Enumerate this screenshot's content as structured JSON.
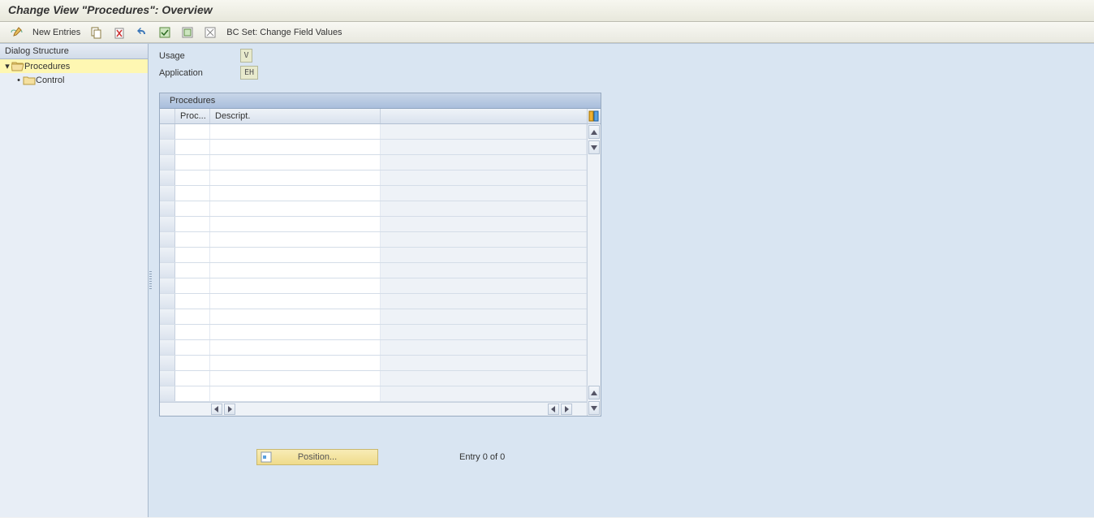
{
  "title": "Change View \"Procedures\": Overview",
  "toolbar": {
    "new_entries": "New Entries",
    "bc_set": "BC Set: Change Field Values"
  },
  "sidebar": {
    "header": "Dialog Structure",
    "root": {
      "label": "Procedures",
      "expanded": true,
      "selected": true
    },
    "child": {
      "label": "Control"
    }
  },
  "fields": {
    "usage_label": "Usage",
    "usage_value": "V",
    "application_label": "Application",
    "application_value": "EH"
  },
  "table": {
    "title": "Procedures",
    "col_proc": "Proc...",
    "col_descript": "Descript.",
    "blank_rows": 18
  },
  "footer": {
    "position_label": "Position...",
    "entry_status": "Entry 0 of 0"
  }
}
